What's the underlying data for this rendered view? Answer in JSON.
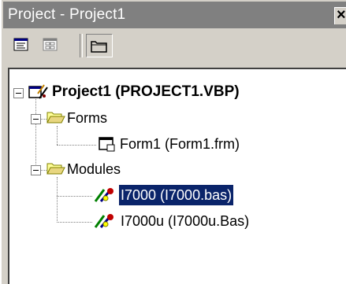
{
  "window": {
    "title": "Project - Project1",
    "close_glyph": "×"
  },
  "toolbar": {
    "buttons": [
      {
        "icon": "view-code-icon"
      },
      {
        "icon": "view-object-icon"
      },
      {
        "icon": "toggle-folders-icon",
        "pressed": true
      }
    ]
  },
  "tree": {
    "project": {
      "label": "Project1 (PROJECT1.VBP)",
      "icon": "project-icon"
    },
    "forms_folder": {
      "label": "Forms",
      "icon": "folder-open-icon"
    },
    "form1": {
      "label": "Form1 (Form1.frm)",
      "icon": "form-icon"
    },
    "modules_folder": {
      "label": "Modules",
      "icon": "folder-open-icon"
    },
    "module1": {
      "label": "I7000 (I7000.bas)",
      "icon": "module-icon",
      "selected": true
    },
    "module2": {
      "label": "I7000u (I7000u.Bas)",
      "icon": "module-icon"
    }
  },
  "colors": {
    "titlebar_inactive": "#808080",
    "selection": "#0a246a",
    "chrome": "#d4d0c8"
  }
}
